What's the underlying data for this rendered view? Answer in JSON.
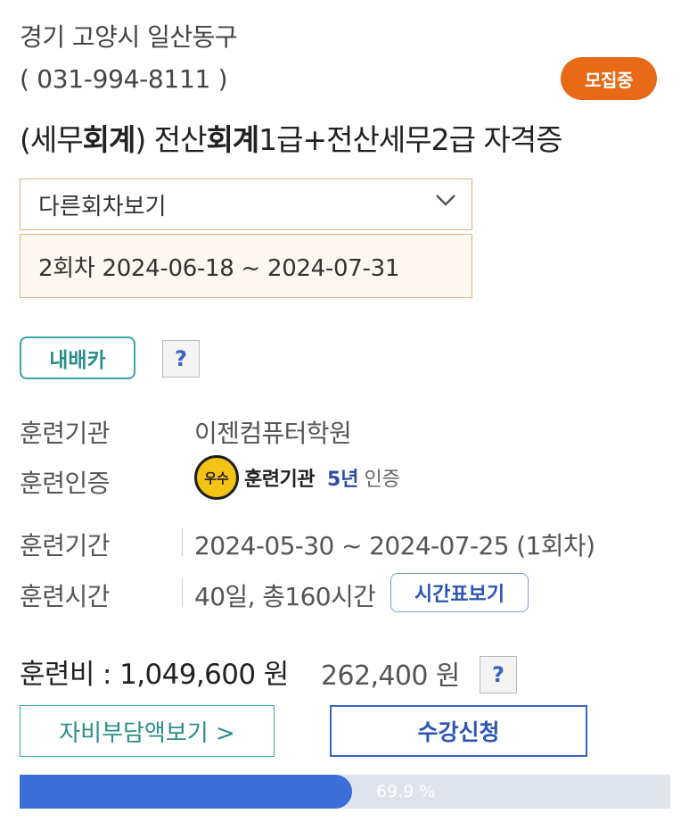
{
  "header": {
    "region": "경기 고양시 일산동구",
    "phone": "( 031-994-8111 )",
    "status_badge": "모집중",
    "title_parts": [
      "(세무",
      "회계",
      ") 전산",
      "회계",
      "1급+전산세무2급 자격증"
    ]
  },
  "round_select": {
    "label": "다른회차보기",
    "current_round": "2회차 2024-06-18 ~ 2024-07-31"
  },
  "card": {
    "label": "내배카",
    "help": "?"
  },
  "info": {
    "institution_label": "훈련기관",
    "institution_value": "이젠컴퓨터학원",
    "cert_label": "훈련인증",
    "cert_icon_text": "우수",
    "cert_text": "훈련기관",
    "cert_years": "5년",
    "cert_suffix": "인증",
    "period_label": "훈련기간",
    "period_value": "2024-05-30 ~ 2024-07-25 (1회차)",
    "hours_label": "훈련시간",
    "hours_value": "40일, 총160시간",
    "schedule_button": "시간표보기"
  },
  "fee": {
    "label": "훈련비 : 1,049,600 원",
    "self_pay": "262,400 원",
    "help": "?"
  },
  "actions": {
    "self_pay_button": "자비부담액보기 >",
    "apply_button": "수강신청"
  },
  "progress": {
    "percent": 69.9,
    "label": "69.9 %"
  },
  "colors": {
    "accent_orange": "#e86a16",
    "teal": "#3aa59e",
    "blue": "#3c6fd8"
  }
}
